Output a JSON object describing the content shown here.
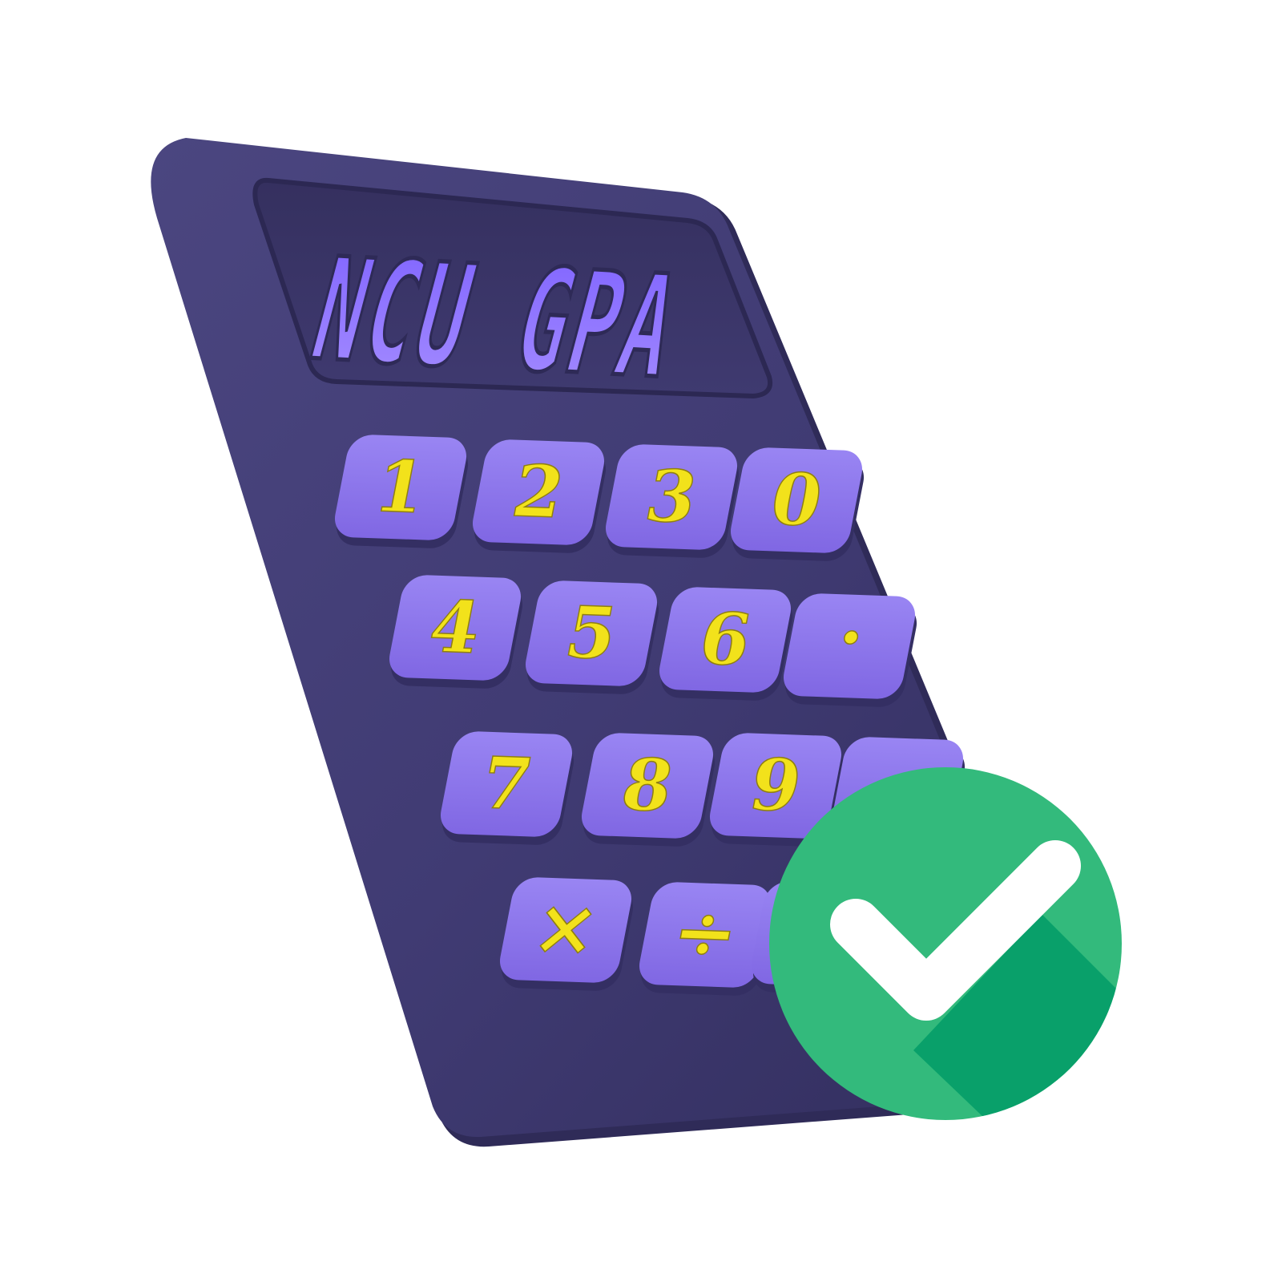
{
  "logo": {
    "title": "NCU GPA"
  },
  "keypad": {
    "rows": [
      [
        "1",
        "2",
        "3",
        "0"
      ],
      [
        "4",
        "5",
        "6",
        "."
      ],
      [
        "7",
        "8",
        "9",
        ""
      ],
      [
        "×",
        "÷",
        ""
      ]
    ]
  },
  "badge": {
    "icon": "checkmark-icon"
  },
  "colors": {
    "body": "#3f3a70",
    "body_dark": "#2f2b58",
    "screen": "#3a3569",
    "screen_text": "#8a6cff",
    "key": "#8c76ec",
    "key_shadow": "#6a55c7",
    "key_text": "#f2e21b",
    "badge_green": "#33ba7c",
    "badge_green_dark": "#09a06a",
    "check": "#ffffff"
  }
}
